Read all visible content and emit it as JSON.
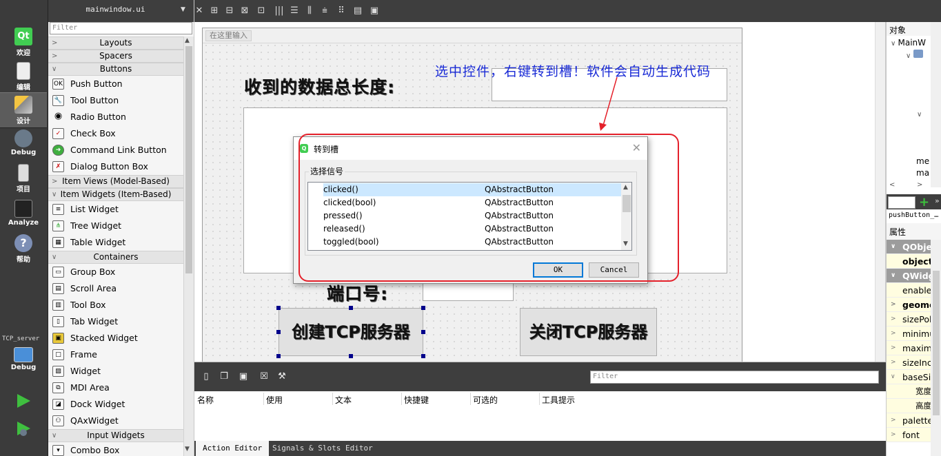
{
  "modebar": {
    "items": [
      {
        "label": "欢迎"
      },
      {
        "label": "编辑"
      },
      {
        "label": "设计"
      },
      {
        "label": "Debug"
      },
      {
        "label": "项目"
      },
      {
        "label": "Analyze"
      },
      {
        "label": "帮助"
      }
    ],
    "project_name": "TCP_server",
    "project_mode": "Debug"
  },
  "widgetbox": {
    "file_name": "mainwindow.ui",
    "filter_placeholder": "Filter",
    "categories": {
      "layouts": "Layouts",
      "spacers": "Spacers",
      "buttons": "Buttons",
      "item_views": "Item Views (Model-Based)",
      "item_widgets": "Item Widgets (Item-Based)",
      "containers": "Containers",
      "input_widgets": "Input Widgets"
    },
    "buttons": [
      "Push Button",
      "Tool Button",
      "Radio Button",
      "Check Box",
      "Command Link Button",
      "Dialog Button Box"
    ],
    "item_widgets": [
      "List Widget",
      "Tree Widget",
      "Table Widget"
    ],
    "containers": [
      "Group Box",
      "Scroll Area",
      "Tool Box",
      "Tab Widget",
      "Stacked Widget",
      "Frame",
      "Widget",
      "MDI Area",
      "Dock Widget",
      "QAxWidget"
    ],
    "input_widgets": [
      "Combo Box"
    ]
  },
  "form": {
    "menu_placeholder": "在这里输入",
    "total_length_label": "收到的数据总长度:",
    "port_label": "端口号:",
    "create_button": "创建TCP服务器",
    "close_button": "关闭TCP服务器"
  },
  "annotation": {
    "text": "选中控件，右键转到槽！软件会自动生成代码",
    "color": "#1a2bd6",
    "box_color": "#e4202a"
  },
  "dialog": {
    "title": "转到槽",
    "group_label": "选择信号",
    "signals": [
      {
        "name": "clicked()",
        "class": "QAbstractButton"
      },
      {
        "name": "clicked(bool)",
        "class": "QAbstractButton"
      },
      {
        "name": "pressed()",
        "class": "QAbstractButton"
      },
      {
        "name": "released()",
        "class": "QAbstractButton"
      },
      {
        "name": "toggled(bool)",
        "class": "QAbstractButton"
      }
    ],
    "ok_label": "OK",
    "cancel_label": "Cancel"
  },
  "action_editor": {
    "filter_placeholder": "Filter",
    "columns": [
      "名称",
      "使用",
      "文本",
      "快捷键",
      "可选的",
      "工具提示"
    ],
    "tabs": [
      "Action Editor",
      "Signals & Slots Editor"
    ]
  },
  "right_panel": {
    "objects_header": "对象",
    "tree_root": "MainW",
    "tree_items": [
      "me",
      "ma"
    ],
    "selected_object": "pushButton_…",
    "properties_header": "属性",
    "properties": [
      {
        "name": "QObje",
        "kind": "group"
      },
      {
        "name": "object",
        "kind": "bold"
      },
      {
        "name": "QWidg",
        "kind": "group"
      },
      {
        "name": "enable",
        "kind": "plain"
      },
      {
        "name": "geome",
        "kind": "bold"
      },
      {
        "name": "sizePol",
        "kind": "plain"
      },
      {
        "name": "minimu",
        "kind": "plain"
      },
      {
        "name": "maxim",
        "kind": "plain"
      },
      {
        "name": "sizeInc",
        "kind": "plain"
      },
      {
        "name": "baseSi",
        "kind": "plain"
      },
      {
        "name": "宽度",
        "kind": "sub"
      },
      {
        "name": "高度",
        "kind": "sub"
      },
      {
        "name": "palette",
        "kind": "plain"
      },
      {
        "name": "font",
        "kind": "plain"
      }
    ]
  }
}
